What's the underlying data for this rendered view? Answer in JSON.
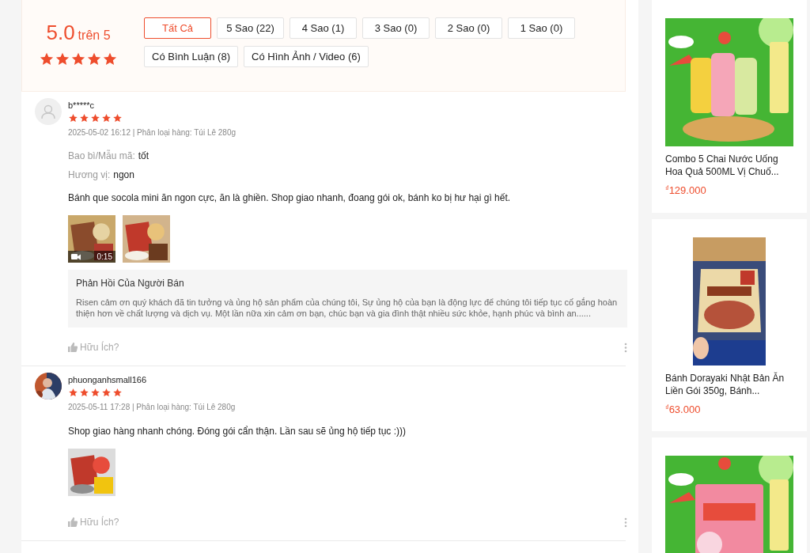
{
  "summary": {
    "score": "5.0",
    "out_of": "trên 5",
    "stars": 5
  },
  "filters": [
    {
      "label": "Tất Cả",
      "selected": true
    },
    {
      "label": "5 Sao (22)",
      "selected": false
    },
    {
      "label": "4 Sao (1)",
      "selected": false
    },
    {
      "label": "3 Sao (0)",
      "selected": false
    },
    {
      "label": "2 Sao (0)",
      "selected": false
    },
    {
      "label": "1 Sao (0)",
      "selected": false
    },
    {
      "label": "Có Bình Luận (8)",
      "selected": false
    },
    {
      "label": "Có Hình Ảnh / Video (6)",
      "selected": false
    }
  ],
  "reviews": [
    {
      "author": "b*****c",
      "avatar": {
        "kind": "icon"
      },
      "stars": 5,
      "meta": "2025-05-02 16:12 | Phân loại hàng: Túi Lê 280g",
      "attributes": [
        {
          "label": "Bao bì/Mẫu mã:",
          "value": "tốt"
        },
        {
          "label": "Hương vị:",
          "value": "ngon"
        }
      ],
      "comment": "Bánh que socola mini ăn ngon cực, ăn là ghiền. Shop giao nhanh, đoang gói ok, bánh ko bị hư hại gì hết.",
      "media": [
        {
          "kind": "video",
          "duration": "0:15"
        },
        {
          "kind": "picture"
        }
      ],
      "seller_reply": {
        "title": "Phản Hồi Của Người Bán",
        "text": "Risen cảm ơn quý khách đã tin tưởng và ủng hộ sản phẩm của chúng tôi, Sự ủng hộ của bạn là động lực để chúng tôi tiếp tục cố gắng hoàn thiện hơn về chất lượng và dịch vụ. Một lần nữa xin cảm ơn bạn, chúc bạn và gia đình thật nhiều sức khỏe, hạnh phúc và bình an......"
      },
      "helpful": "Hữu Ích?"
    },
    {
      "author": "phuonganhsmall166",
      "avatar": {
        "kind": "picture"
      },
      "stars": 5,
      "meta": "2025-05-11 17:28 | Phân loại hàng: Túi Lê 280g",
      "comment": "Shop giao hàng nhanh chóng. Đóng gói cẩn thận. Lần sau sẽ ủng hộ tiếp tục :)))",
      "media": [
        {
          "kind": "picture"
        }
      ],
      "helpful": "Hữu Ích?"
    }
  ],
  "products": [
    {
      "image": {
        "kind": "picture"
      },
      "name": "Combo 5 Chai Nước Uống Hoa Quả 500ML Vị Chuố...",
      "currency": "₫",
      "price": "129.000"
    },
    {
      "image": {
        "kind": "picture"
      },
      "name": "Bánh Dorayaki Nhật Bản Ăn Liền Gói 350g, Bánh...",
      "currency": "₫",
      "price": "63.000"
    },
    {
      "image": {
        "kind": "picture"
      }
    }
  ]
}
